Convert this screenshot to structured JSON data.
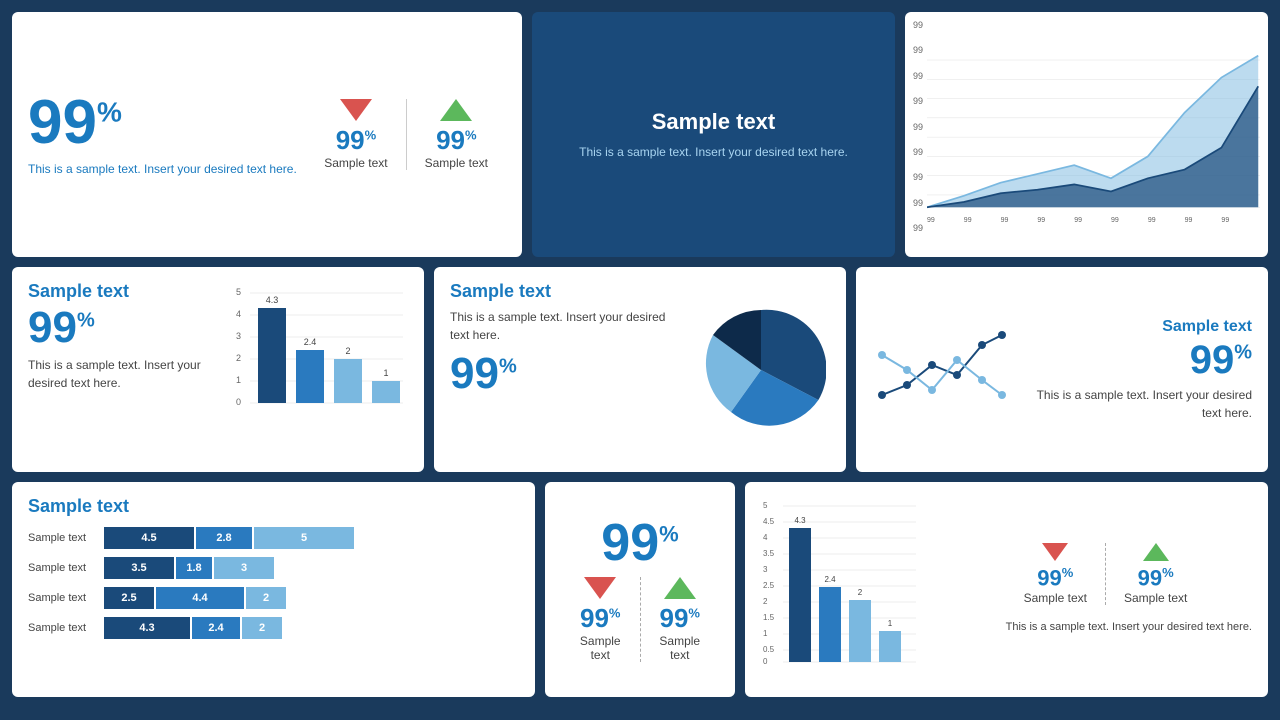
{
  "colors": {
    "blue_dark": "#1a4a7a",
    "blue_mid": "#2a7abf",
    "blue_light": "#7ab8e0",
    "accent_blue": "#1a7abf",
    "red": "#d9534f",
    "green": "#5cb85c",
    "white": "#ffffff",
    "bg": "#1a3a5c"
  },
  "card1": {
    "big_percent": "99",
    "big_suffix": "%",
    "desc": "This is a sample text. Insert your desired text here.",
    "indicator1": {
      "percent": "99",
      "suffix": "%",
      "label": "Sample text",
      "direction": "down"
    },
    "indicator2": {
      "percent": "99",
      "suffix": "%",
      "label": "Sample text",
      "direction": "up"
    }
  },
  "card2": {
    "title": "Sample text",
    "desc": "This is a sample text. Insert your desired text here."
  },
  "card3": {
    "y_labels": [
      "99",
      "99",
      "99",
      "99",
      "99",
      "99",
      "99",
      "99",
      "99"
    ],
    "x_labels": [
      "99",
      "99",
      "99",
      "99",
      "99",
      "99",
      "99",
      "99",
      "99"
    ]
  },
  "card_r2_left": {
    "title": "Sample text",
    "percent": "99",
    "suffix": "%",
    "desc": "This is a sample text. Insert your desired text here.",
    "chart": {
      "bars": [
        {
          "label": "",
          "val": 4.3,
          "color": "#1a4a7a"
        },
        {
          "label": "",
          "val": 2.4,
          "color": "#2a7abf"
        },
        {
          "label": "",
          "val": 2,
          "color": "#7ab8e0"
        },
        {
          "label": "",
          "val": 1,
          "color": "#7ab8e0"
        }
      ],
      "y_max": 5,
      "y_labels": [
        "5",
        "4",
        "3",
        "2",
        "1",
        "0"
      ],
      "val_labels": [
        "4.3",
        "2.4",
        "2",
        "1"
      ]
    }
  },
  "card_r2_mid": {
    "title": "Sample text",
    "desc": "This is a sample text. Insert your desired text here.",
    "percent": "99",
    "suffix": "%",
    "pie": {
      "slices": [
        {
          "pct": 40,
          "color": "#1a4a7a"
        },
        {
          "pct": 25,
          "color": "#2a7abf"
        },
        {
          "pct": 20,
          "color": "#7ab8e0"
        },
        {
          "pct": 15,
          "color": "#0d2a4a"
        }
      ]
    }
  },
  "card_r2_right": {
    "title": "Sample text",
    "percent": "99",
    "suffix": "%",
    "desc": "This is a sample text. Insert your desired text here."
  },
  "card_r3_left": {
    "title": "Sample text",
    "rows": [
      {
        "label": "Sample text",
        "v1": "4.5",
        "w1": 90,
        "v2": "2.8",
        "w2": 56,
        "v3": "5",
        "w3": 100
      },
      {
        "label": "Sample text",
        "v1": "3.5",
        "w1": 70,
        "v2": "1.8",
        "w2": 36,
        "v3": "3",
        "w3": 60
      },
      {
        "label": "Sample text",
        "v1": "2.5",
        "w1": 50,
        "v2": "4.4",
        "w2": 88,
        "v3": "2",
        "w3": 40
      },
      {
        "label": "Sample text",
        "v1": "4.3",
        "w1": 86,
        "v2": "2.4",
        "w2": 48,
        "v3": "2",
        "w3": 40
      }
    ]
  },
  "card_r3_mid": {
    "percent": "99",
    "suffix": "%",
    "indicator1": {
      "percent": "99",
      "suffix": "%",
      "label": "Sample text",
      "direction": "down"
    },
    "indicator2": {
      "percent": "99",
      "suffix": "%",
      "label": "Sample text",
      "direction": "up"
    }
  },
  "card_r3_right": {
    "chart": {
      "bars": [
        {
          "val": 4.3,
          "color": "#1a4a7a"
        },
        {
          "val": 2.4,
          "color": "#2a7abf"
        },
        {
          "val": 2,
          "color": "#7ab8e0"
        },
        {
          "val": 1,
          "color": "#7ab8e0"
        }
      ],
      "y_labels": [
        "5",
        "4.5",
        "4",
        "3.5",
        "3",
        "2.5",
        "2",
        "1.5",
        "1",
        "0.5",
        "0"
      ],
      "val_labels": [
        "4.3",
        "2.4",
        "2",
        "1"
      ]
    },
    "indicator1": {
      "percent": "99",
      "suffix": "%",
      "label": "Sample text",
      "direction": "down"
    },
    "indicator2": {
      "percent": "99",
      "suffix": "%",
      "label": "Sample text",
      "direction": "up"
    },
    "desc": "This is a sample text. Insert your desired text here."
  }
}
